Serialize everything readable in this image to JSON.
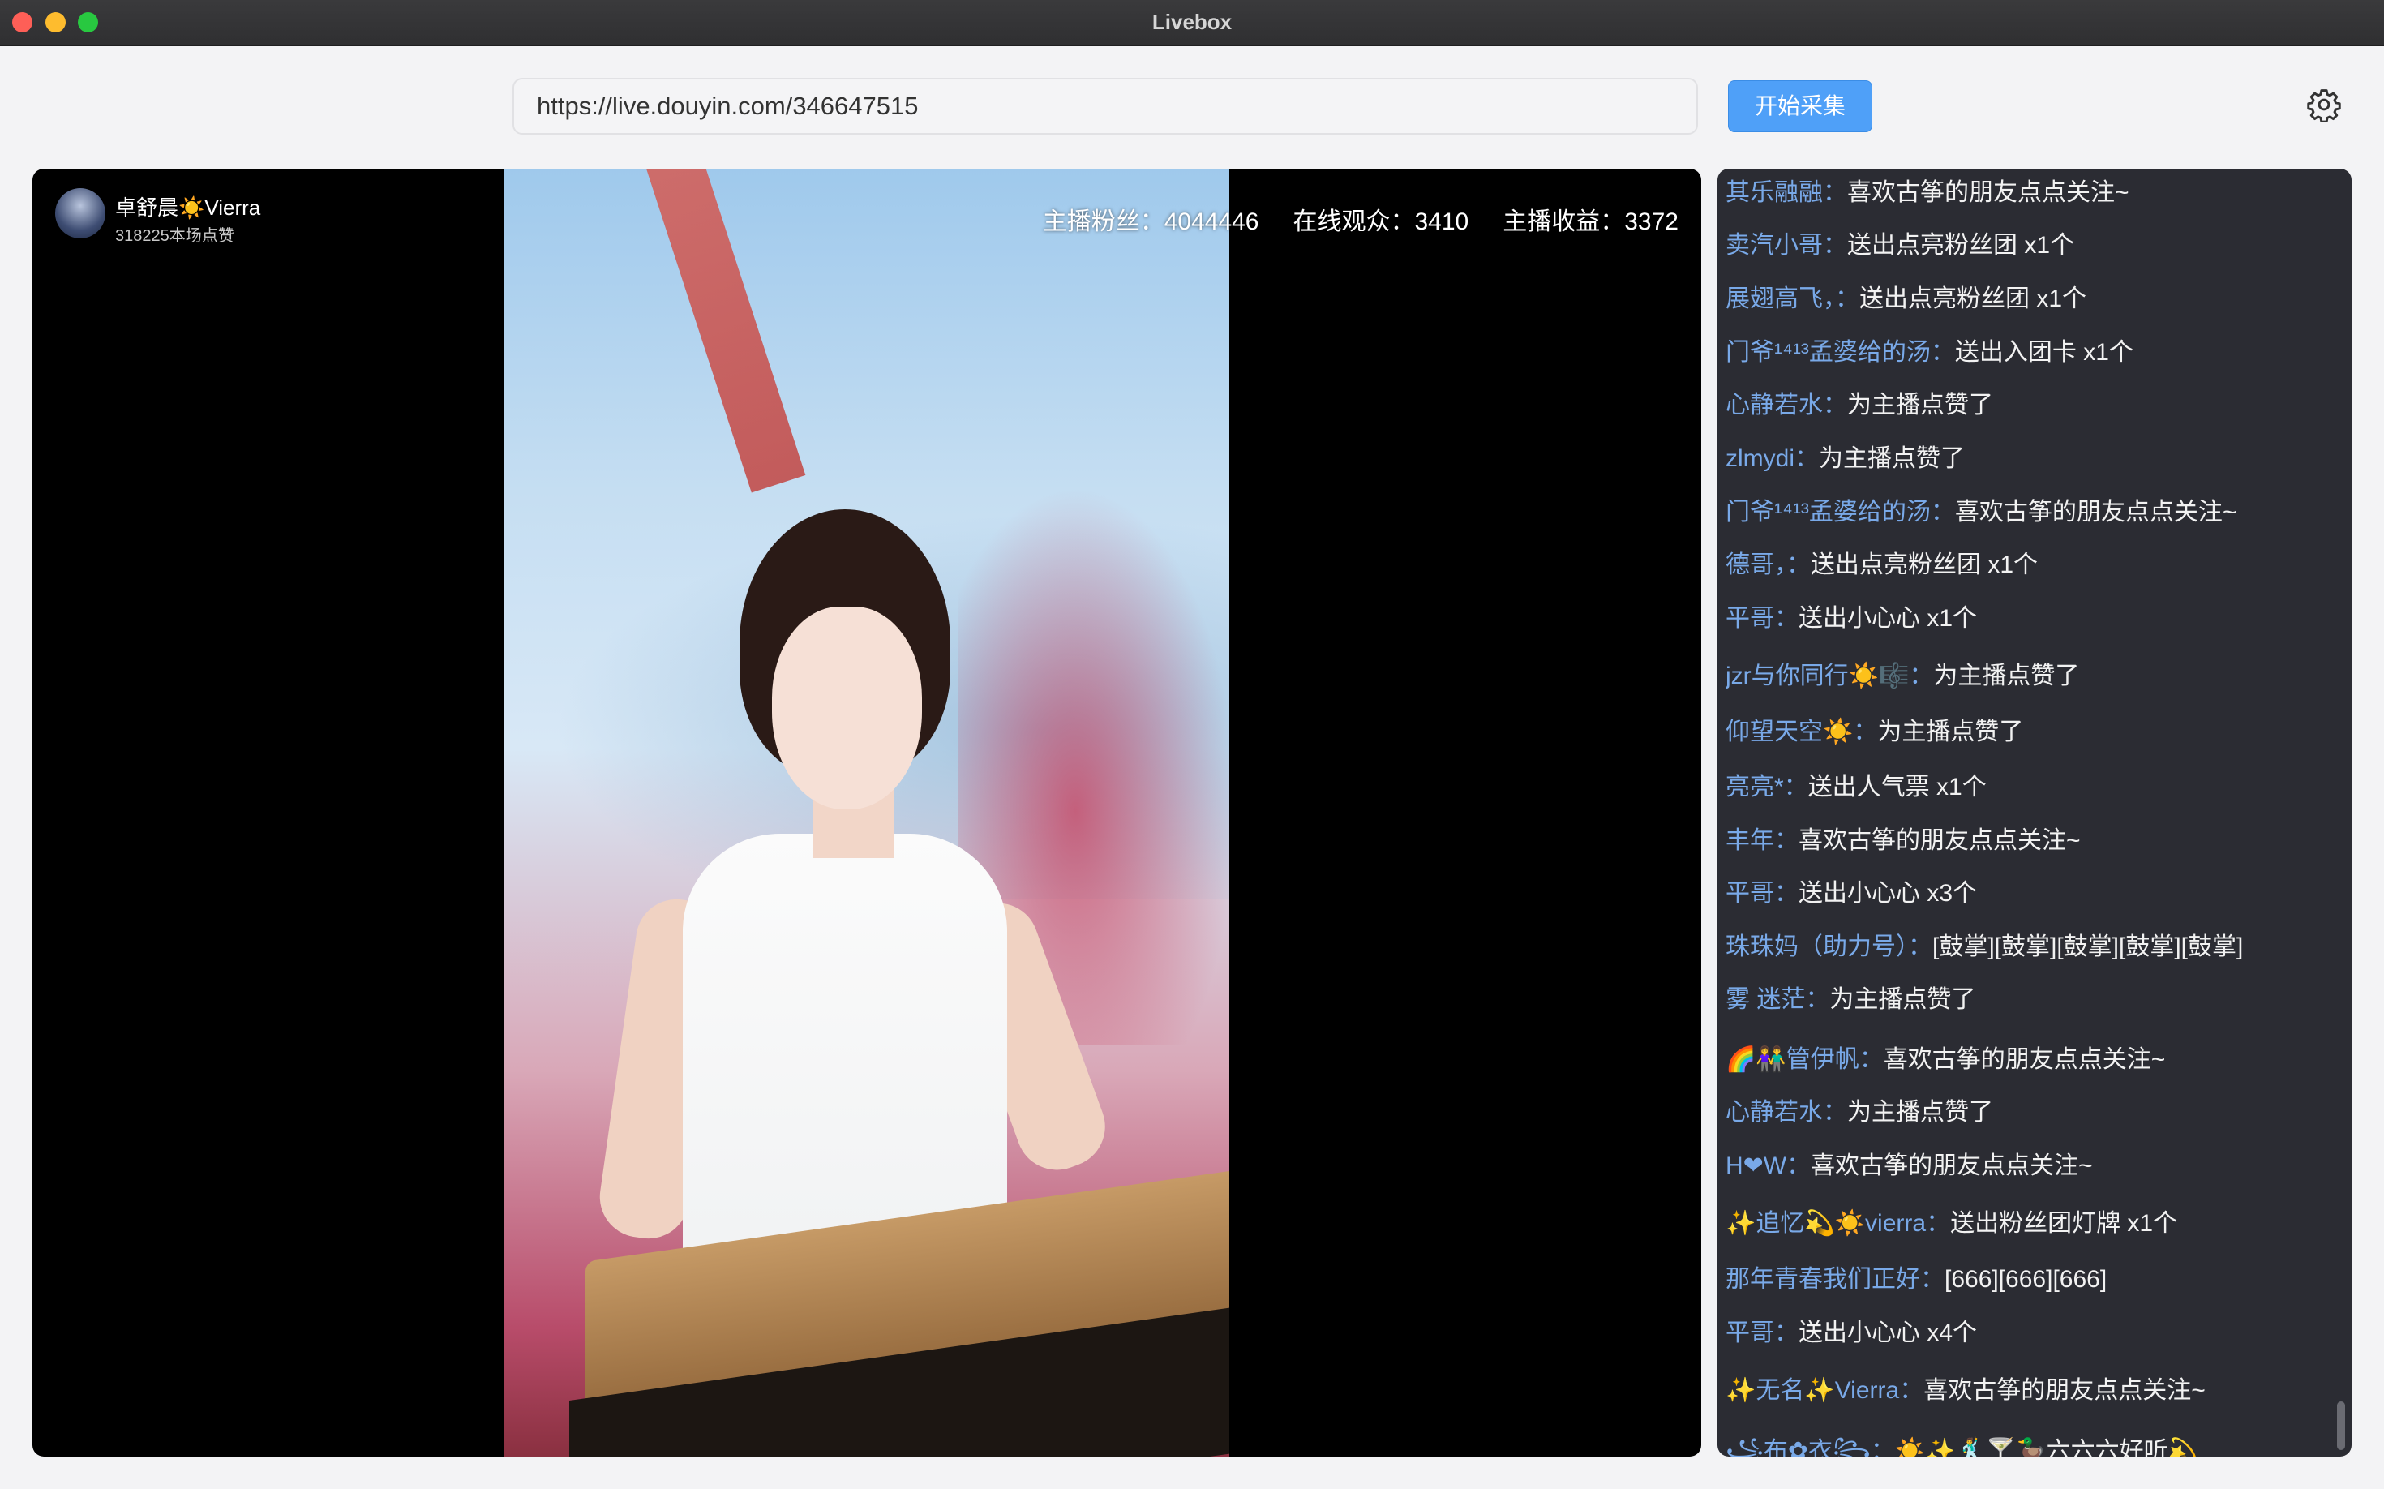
{
  "window": {
    "title": "Livebox"
  },
  "toolbar": {
    "url_value": "https://live.douyin.com/346647515",
    "start_label": "开始采集"
  },
  "streamer": {
    "name": "卓舒晨☀️Vierra",
    "likes": "318225本场点赞"
  },
  "stats": {
    "fans": "主播粉丝：4044446",
    "online": "在线观众：3410",
    "income": "主播收益：3372"
  },
  "chat": [
    {
      "user": "其乐融融：",
      "msg": "喜欢古筝的朋友点点关注~"
    },
    {
      "user": "卖汽小哥：",
      "msg": "送出点亮粉丝团 x1个"
    },
    {
      "user": "展翅高飞，：",
      "msg": "送出点亮粉丝团 x1个"
    },
    {
      "user": "门爷¹⁴¹³孟婆给的汤：",
      "msg": "送出入团卡 x1个"
    },
    {
      "user": "心静若水：",
      "msg": "为主播点赞了"
    },
    {
      "user": "zlmydi：",
      "msg": "为主播点赞了"
    },
    {
      "user": "门爷¹⁴¹³孟婆给的汤：",
      "msg": "喜欢古筝的朋友点点关注~"
    },
    {
      "user": "德哥，：",
      "msg": "送出点亮粉丝团 x1个"
    },
    {
      "user": "平哥：",
      "msg": "送出小心心 x1个"
    },
    {
      "user": "jzr与你同行☀️🎼：",
      "msg": "为主播点赞了"
    },
    {
      "user": "仰望天空☀️：",
      "msg": "为主播点赞了"
    },
    {
      "user": "亮亮*：",
      "msg": "送出人气票 x1个"
    },
    {
      "user": "丰年：",
      "msg": "喜欢古筝的朋友点点关注~"
    },
    {
      "user": "平哥：",
      "msg": "送出小心心 x3个"
    },
    {
      "user": "珠珠妈（助力号）：",
      "msg": "[鼓掌][鼓掌][鼓掌][鼓掌][鼓掌]"
    },
    {
      "user": "雾 迷茫：",
      "msg": "为主播点赞了"
    },
    {
      "user": "🌈👫管伊帆：",
      "msg": "喜欢古筝的朋友点点关注~"
    },
    {
      "user": "心静若水：",
      "msg": "为主播点赞了"
    },
    {
      "user": "H❤W：",
      "msg": "喜欢古筝的朋友点点关注~"
    },
    {
      "user": "✨追忆💫☀️vierra：",
      "msg": "送出粉丝团灯牌 x1个"
    },
    {
      "user": "那年青春我们正好：",
      "msg": "[666][666][666]"
    },
    {
      "user": "平哥：",
      "msg": "送出小心心 x4个"
    },
    {
      "user": "✨无名✨Vierra：",
      "msg": "喜欢古筝的朋友点点关注~"
    },
    {
      "user": "꧁布✿衣꧂：",
      "msg": "☀️✨🕺🍸🦆六六六好听💫"
    }
  ],
  "colors": {
    "accent": "#4fa0f8",
    "chat_user": "#79a9e8",
    "chat_bg": "#2b2c33"
  },
  "icons": {
    "settings": "gear-icon"
  }
}
